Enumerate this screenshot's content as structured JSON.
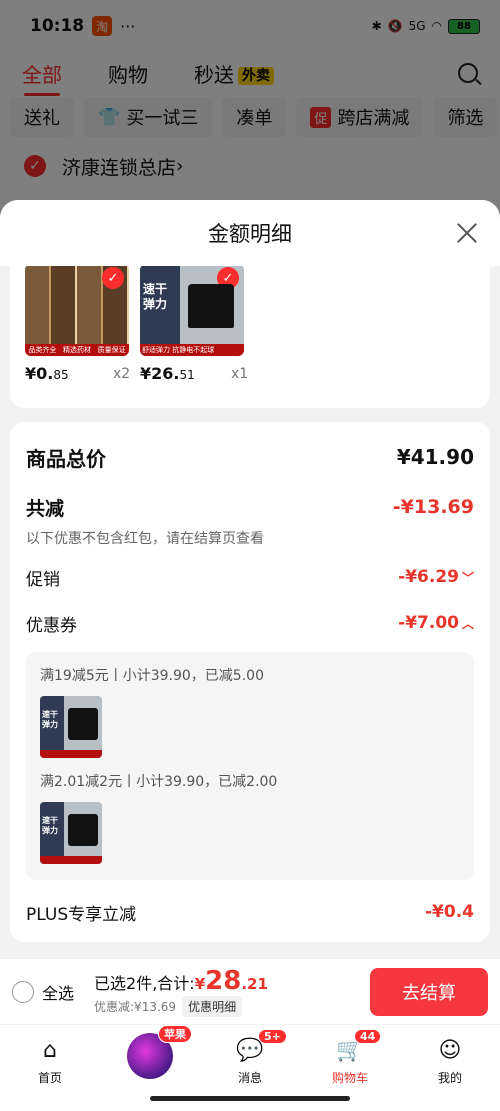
{
  "status_bar": {
    "time": "10:18",
    "app_badge": "淘",
    "dots": "···",
    "signal": "5G",
    "battery": "88"
  },
  "top_nav": {
    "tabs": [
      "全部",
      "购物",
      "秒送"
    ],
    "tag": "外卖"
  },
  "filter_chips": [
    "送礼",
    "买一试三",
    "凑单",
    "跨店满减",
    "筛选"
  ],
  "filter_chip_tag": "促",
  "shop": {
    "name": "济康连锁总店"
  },
  "sheet": {
    "title": "金额明细",
    "products": [
      {
        "price_int": "¥0.",
        "price_dec": "85",
        "qty": "x2",
        "band": [
          "品类齐全",
          "精选药材",
          "质量保证"
        ]
      },
      {
        "price_int": "¥26.",
        "price_dec": "51",
        "qty": "x1",
        "title_line1": "速干",
        "title_line2": "弹力",
        "band": "舒适弹力 抗静电不起球"
      }
    ],
    "total_label": "商品总价",
    "total_value": "¥41.90",
    "reduce_label": "共减",
    "reduce_value": "-¥13.69",
    "reduce_note": "以下优惠不包含红包，请在结算页查看",
    "promo_label": "促销",
    "promo_value": "-¥6.29",
    "coupon_label": "优惠券",
    "coupon_value": "-¥7.00",
    "coupon_lines": [
      "满19减5元丨小计39.90，已减5.00",
      "满2.01减2元丨小计39.90，已减2.00"
    ],
    "plus_label": "PLUS专享立减",
    "plus_value": "-¥0.4"
  },
  "checkout": {
    "select_all": "全选",
    "selected": "已选2件,合计:",
    "currency": "¥",
    "amount_int": "28",
    "amount_dec": ".21",
    "discount": "优惠减:¥13.69",
    "detail_btn": "优惠明细",
    "submit": "去结算"
  },
  "tabbar": {
    "items": [
      "首页",
      "",
      "消息",
      "购物车",
      "我的"
    ],
    "apple_badge": "苹果",
    "msg_badge": "5+",
    "cart_badge": "44"
  },
  "colors": {
    "accent": "#e8352c",
    "checkout_btn": "#f5373f"
  }
}
